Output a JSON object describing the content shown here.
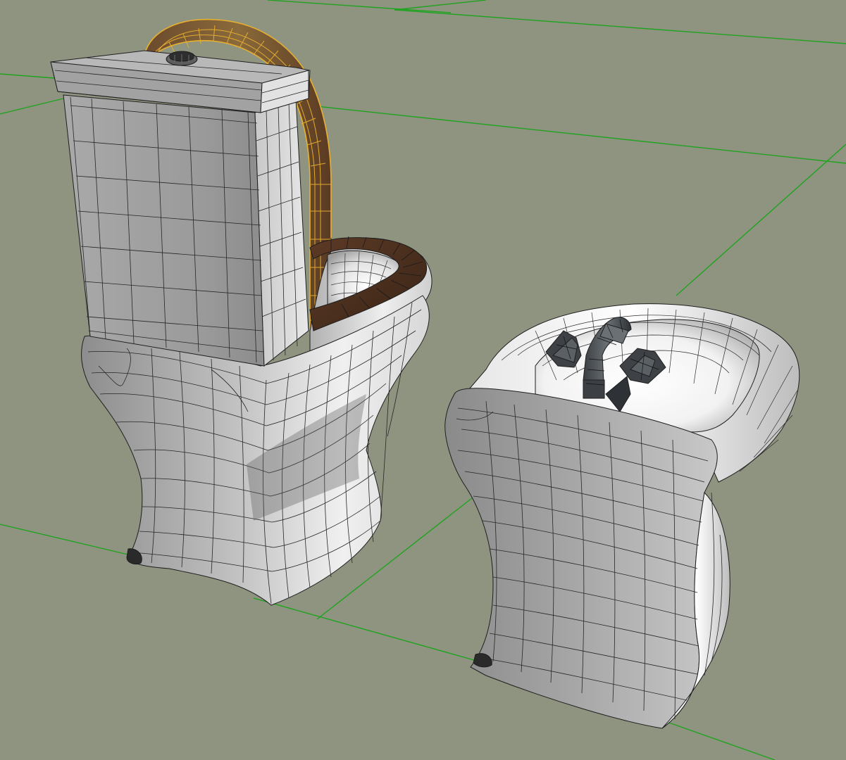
{
  "viewport": {
    "background": "#8f9480",
    "grid_color": "#1fa31f",
    "wire_color": "#1e1e1e",
    "selection_color": "#e8b030",
    "shade_light": "#f2f2f2",
    "shade_mid": "#c4c4c4",
    "shade_dark": "#7d7d7d",
    "seat_color": "#4a2e1e"
  },
  "scene": {
    "objects": [
      {
        "name": "toilet",
        "selected_part": "seat-lid"
      },
      {
        "name": "bidet",
        "parts": [
          "faucet",
          "left-handle",
          "right-handle"
        ]
      }
    ]
  }
}
